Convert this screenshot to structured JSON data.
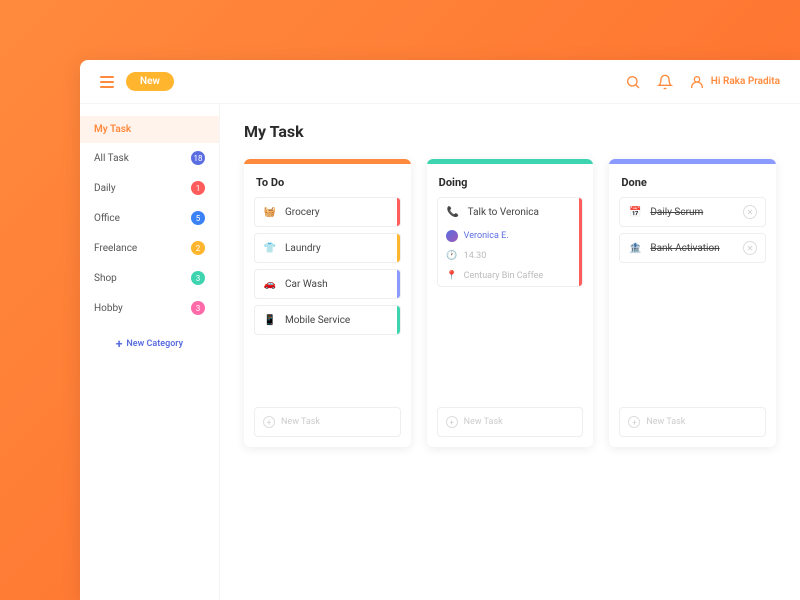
{
  "header": {
    "newLabel": "New",
    "greeting": "Hi Raka Pradita"
  },
  "sidebar": {
    "items": [
      {
        "label": "My Task",
        "active": true
      },
      {
        "label": "All Task",
        "count": "18",
        "color": "#5b6ee1"
      },
      {
        "label": "Daily",
        "count": "1",
        "color": "#ff5c5c"
      },
      {
        "label": "Office",
        "count": "5",
        "color": "#3b82f6"
      },
      {
        "label": "Freelance",
        "count": "2",
        "color": "#ffb52e"
      },
      {
        "label": "Shop",
        "count": "3",
        "color": "#3fd4b0"
      },
      {
        "label": "Hobby",
        "count": "3",
        "color": "#ff6aa8"
      }
    ],
    "newCategory": "New Category"
  },
  "page": {
    "title": "My Task"
  },
  "columns": {
    "todo": {
      "title": "To Do",
      "barColor": "#ff8a3d",
      "newTask": "New Task",
      "cards": [
        {
          "label": "Grocery",
          "iconColor": "#ff5c5c",
          "stripe": "#ff5c5c"
        },
        {
          "label": "Laundry",
          "iconColor": "#ffb52e",
          "stripe": "#ffb52e"
        },
        {
          "label": "Car Wash",
          "iconColor": "#5b6ee1",
          "stripe": "#8b9aff"
        },
        {
          "label": "Mobile Service",
          "iconColor": "#3fd4b0",
          "stripe": "#3fd4b0"
        }
      ]
    },
    "doing": {
      "title": "Doing",
      "barColor": "#3fd4b0",
      "newTask": "New Task",
      "card": {
        "label": "Talk to Veronica",
        "iconColor": "#ff5c5c",
        "stripe": "#ff5c5c",
        "person": "Veronica E.",
        "time": "14.30",
        "location": "Centuary Bin Caffee"
      }
    },
    "done": {
      "title": "Done",
      "barColor": "#8b9aff",
      "newTask": "New Task",
      "cards": [
        {
          "label": "Daily Scrum"
        },
        {
          "label": "Bank Activation"
        }
      ]
    }
  }
}
